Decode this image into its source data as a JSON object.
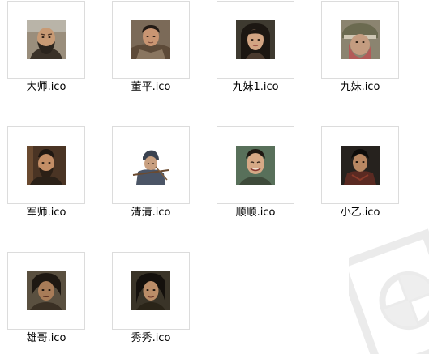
{
  "explorer": {
    "files": [
      {
        "label": "大师.ico",
        "icon": "bald-bearded-man-portrait"
      },
      {
        "label": "董平.ico",
        "icon": "armored-warrior-portrait"
      },
      {
        "label": "九妹1.ico",
        "icon": "young-woman-portrait"
      },
      {
        "label": "九妹.ico",
        "icon": "veiled-woman-portrait"
      },
      {
        "label": "军师.ico",
        "icon": "bearded-strategist-portrait"
      },
      {
        "label": "清清.ico",
        "icon": "archer-woman-portrait"
      },
      {
        "label": "顺顺.ico",
        "icon": "smiling-man-portrait"
      },
      {
        "label": "小乙.ico",
        "icon": "young-warrior-portrait"
      },
      {
        "label": "雄哥.ico",
        "icon": "rugged-man-portrait"
      },
      {
        "label": "秀秀.ico",
        "icon": "long-haired-man-portrait"
      }
    ]
  }
}
